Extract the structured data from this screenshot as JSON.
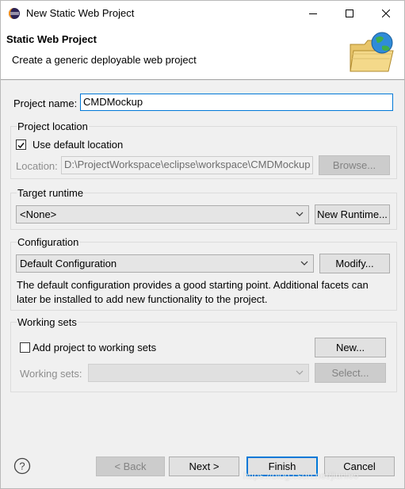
{
  "window": {
    "title": "New Static Web Project"
  },
  "banner": {
    "title": "Static Web Project",
    "description": "Create a generic deployable web project"
  },
  "project_name": {
    "label": "Project name:",
    "value": "CMDMockup"
  },
  "project_location": {
    "group_title": "Project location",
    "use_default_label": "Use default location",
    "use_default_checked": true,
    "location_label": "Location:",
    "location_value": "D:\\ProjectWorkspace\\eclipse\\workspace\\CMDMockup",
    "browse_label": "Browse..."
  },
  "target_runtime": {
    "group_title": "Target runtime",
    "selected": "<None>",
    "new_runtime_label": "New Runtime..."
  },
  "configuration": {
    "group_title": "Configuration",
    "selected": "Default Configuration",
    "modify_label": "Modify...",
    "description": "The default configuration provides a good starting point. Additional facets can later be installed to add new functionality to the project."
  },
  "working_sets": {
    "group_title": "Working sets",
    "add_label": "Add project to working sets",
    "add_checked": false,
    "new_label": "New...",
    "sets_label": "Working sets:",
    "select_label": "Select..."
  },
  "footer": {
    "back_label": "< Back",
    "next_label": "Next >",
    "finish_label": "Finish",
    "cancel_label": "Cancel"
  },
  "watermark": "https://blog.csdn.net/jiunleo"
}
